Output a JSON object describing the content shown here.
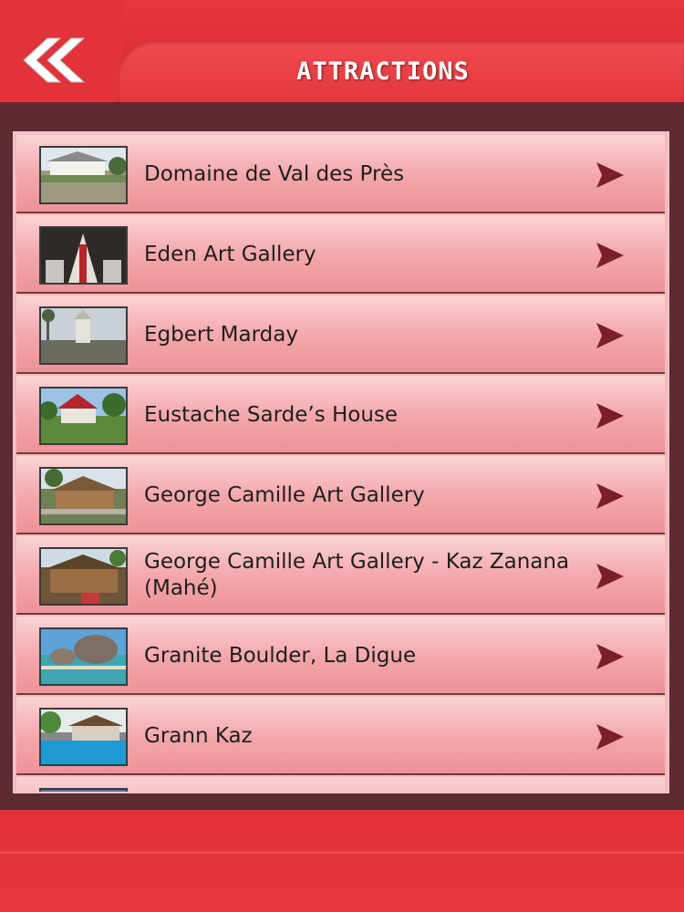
{
  "header": {
    "title": "ATTRACTIONS",
    "back_icon": "double-chevron-left-icon"
  },
  "colors": {
    "brand_red": "#e8313a",
    "panel_maroon": "#5e2a33",
    "row_pink": "#f3a6aa",
    "arrow_maroon": "#7a1f2a"
  },
  "attractions": [
    {
      "label": "Domaine de Val des Près",
      "thumb": "colonial-house-photo"
    },
    {
      "label": "Eden Art Gallery",
      "thumb": "gallery-interior-photo"
    },
    {
      "label": "Egbert Marday",
      "thumb": "church-photo"
    },
    {
      "label": "Eustache Sarde’s House",
      "thumb": "red-roof-house-photo"
    },
    {
      "label": "George Camille Art Gallery",
      "thumb": "wooden-house-photo"
    },
    {
      "label": "George Camille Art Gallery - Kaz Zanana (Mahé)",
      "thumb": "gallery-cottage-photo"
    },
    {
      "label": "Granite Boulder, La Digue",
      "thumb": "beach-boulder-photo"
    },
    {
      "label": "Grann Kaz",
      "thumb": "pool-villa-photo"
    }
  ]
}
